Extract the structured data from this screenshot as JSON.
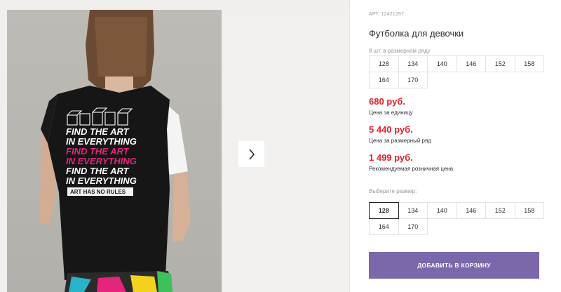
{
  "product": {
    "article": "АРТ. 12421257",
    "title": "Футболка для девочки"
  },
  "shirt_print": {
    "line1": "FIND THE ART",
    "line2": "IN EVERYTHING",
    "line3": "FIND THE ART",
    "line4": "IN EVERYTHING",
    "line5": "FIND THE ART",
    "line6": "IN EVERYTHING",
    "badge": "ART HAS NO RULES"
  },
  "size_row": {
    "caption": "8 шт. в размерном ряду",
    "sizes": [
      "128",
      "134",
      "140",
      "146",
      "152",
      "158",
      "164",
      "170"
    ]
  },
  "prices": [
    {
      "value": "680 руб.",
      "note": "Цена за единицу"
    },
    {
      "value": "5 440 руб.",
      "note": "Цена за размерный ряд"
    },
    {
      "value": "1 499 руб.",
      "note": "Рекомендуемая розничная цена"
    }
  ],
  "size_select": {
    "caption": "Выберите размер:",
    "selected": "128",
    "sizes": [
      "128",
      "134",
      "140",
      "146",
      "152",
      "158",
      "164",
      "170"
    ]
  },
  "cart_button": "ДОБАВИТЬ В КОРЗИНУ",
  "colors": {
    "price": "#e3202a",
    "cart_button": "#7a68ab",
    "print_accent": "#e5247c"
  },
  "icons": {
    "next": "chevron-right-icon"
  }
}
